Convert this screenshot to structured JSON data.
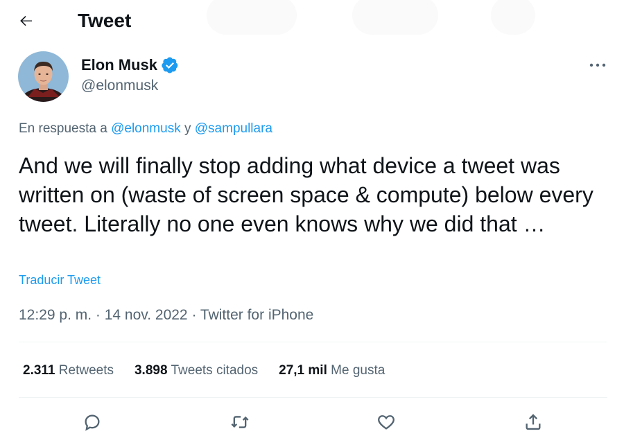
{
  "header": {
    "title": "Tweet",
    "back_icon": "arrow-left-icon"
  },
  "author": {
    "name": "Elon Musk",
    "handle": "@elonmusk",
    "verified_icon": "verified-badge-icon",
    "avatar_description_icon": "avatar-photo"
  },
  "reply": {
    "prefix": "En respuesta a ",
    "mention1": "@elonmusk",
    "connector": " y ",
    "mention2": "@sampullara"
  },
  "tweet": {
    "text": "And we will finally stop adding what device a tweet was written on (waste of screen space & compute) below every tweet. Literally no one even knows why we did that …",
    "translate_label": "Traducir Tweet",
    "time": "12:29 p. m.",
    "sep1": " · ",
    "date": "14 nov. 2022",
    "sep2": " · ",
    "source": "Twitter for iPhone"
  },
  "stats": {
    "retweets_count": "2.311",
    "retweets_label": "Retweets",
    "quotes_count": "3.898",
    "quotes_label": "Tweets citados",
    "likes_count": "27,1 mil",
    "likes_label": "Me gusta"
  },
  "actions": {
    "reply_icon": "reply-bubble-icon",
    "retweet_icon": "retweet-icon",
    "like_icon": "heart-icon",
    "share_icon": "share-icon"
  },
  "colors": {
    "accent": "#1d9bf0",
    "text": "#0f1419",
    "secondary": "#536471",
    "divider": "#eff3f4"
  }
}
